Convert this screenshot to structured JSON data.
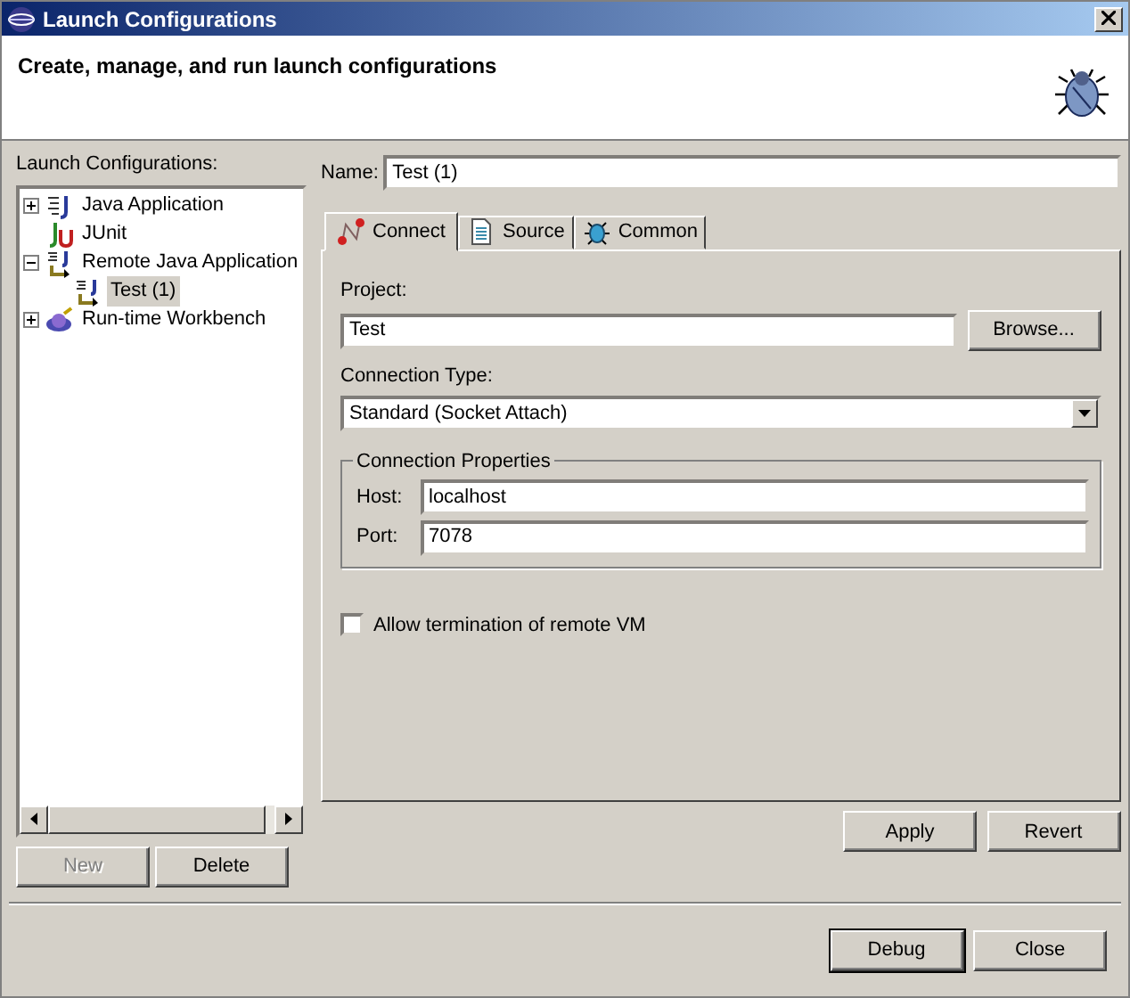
{
  "window": {
    "title": "Launch Configurations"
  },
  "header": {
    "message": "Create, manage, and run launch configurations"
  },
  "sidebar": {
    "label": "Launch Configurations:",
    "tree": [
      {
        "label": "Java Application",
        "kind": "java",
        "expanded": false,
        "selected": false
      },
      {
        "label": "JUnit",
        "kind": "junit",
        "selected": false
      },
      {
        "label": "Remote Java Application",
        "kind": "remote",
        "expanded": true,
        "selected": false,
        "children": [
          {
            "label": "Test (1)",
            "kind": "remote",
            "selected": true
          }
        ]
      },
      {
        "label": "Run-time Workbench",
        "kind": "workbench",
        "expanded": false,
        "selected": false
      }
    ],
    "buttons": [
      {
        "label": "New",
        "disabled": true
      },
      {
        "label": "Delete",
        "disabled": false
      }
    ]
  },
  "name_field": {
    "label": "Name:",
    "value": "Test (1)"
  },
  "tabs": [
    {
      "label": "Connect",
      "kind": "connect",
      "selected": true
    },
    {
      "label": "Source",
      "kind": "source",
      "selected": false
    },
    {
      "label": "Common",
      "kind": "common",
      "selected": false
    }
  ],
  "connect": {
    "project_label": "Project:",
    "project_value": "Test",
    "browse": "Browse...",
    "type_label": "Connection Type:",
    "type_value": "Standard (Socket Attach)",
    "group_title": "Connection Properties",
    "host_label": "Host:",
    "host_value": "localhost",
    "port_label": "Port:",
    "port_value": "7078",
    "allow_termination": {
      "label": "Allow termination of remote VM",
      "checked": false
    }
  },
  "panel_buttons": [
    {
      "label": "Apply",
      "default": false
    },
    {
      "label": "Revert",
      "default": false
    }
  ],
  "footer_buttons": [
    {
      "label": "Debug",
      "default": true
    },
    {
      "label": "Close",
      "default": false
    }
  ]
}
